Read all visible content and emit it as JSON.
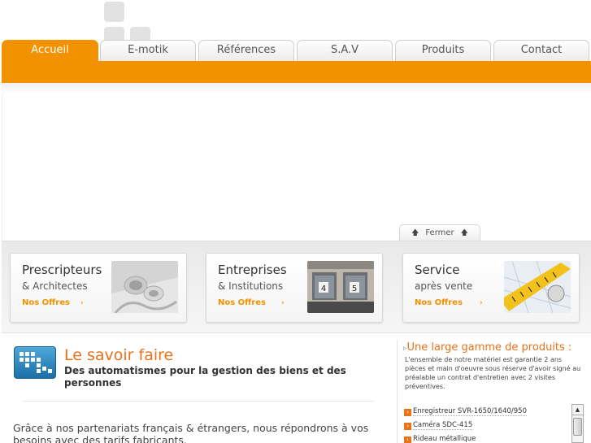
{
  "nav": {
    "tabs": [
      {
        "label": "Accueil",
        "active": true
      },
      {
        "label": "E-motik"
      },
      {
        "label": "Références"
      },
      {
        "label": "S.A.V"
      },
      {
        "label": "Produits"
      },
      {
        "label": "Contact"
      }
    ]
  },
  "colors": {
    "accent": "#f39200",
    "title_orange": "#e8731a"
  },
  "banner": {
    "close_label": "Fermer",
    "close_icon": "arrow-up-icon"
  },
  "cards": [
    {
      "title": "Prescripteurs",
      "subtitle": "& Architectes",
      "link": "Nos Offres",
      "image": "pipes-photo"
    },
    {
      "title": "Entreprises",
      "subtitle": "& Institutions",
      "link": "Nos Offres",
      "image": "loading-docks-photo"
    },
    {
      "title": "Service",
      "subtitle": "après vente",
      "link": "Nos Offres",
      "image": "tape-measure-photo"
    }
  ],
  "main": {
    "title": "Le savoir faire",
    "subtitle": "Des automatismes pour la gestion des biens et des personnes",
    "paragraph": "Grâce à nos partenariats français & étrangers, nous répondrons à vos besoins avec des tarifs fabricants."
  },
  "products": {
    "title": "Une large gamme de produits :",
    "text": "L'ensemble de notre matériel est garantie 2 ans pièces et main d'oeuvre sous réserve d'avoir signé au préalable un contrat d'entretien avec 2 visites préventives.",
    "items": [
      "Enregistreur SVR-1650/1640/950",
      "Caméra SDC-415",
      "Rideau métallique"
    ]
  }
}
